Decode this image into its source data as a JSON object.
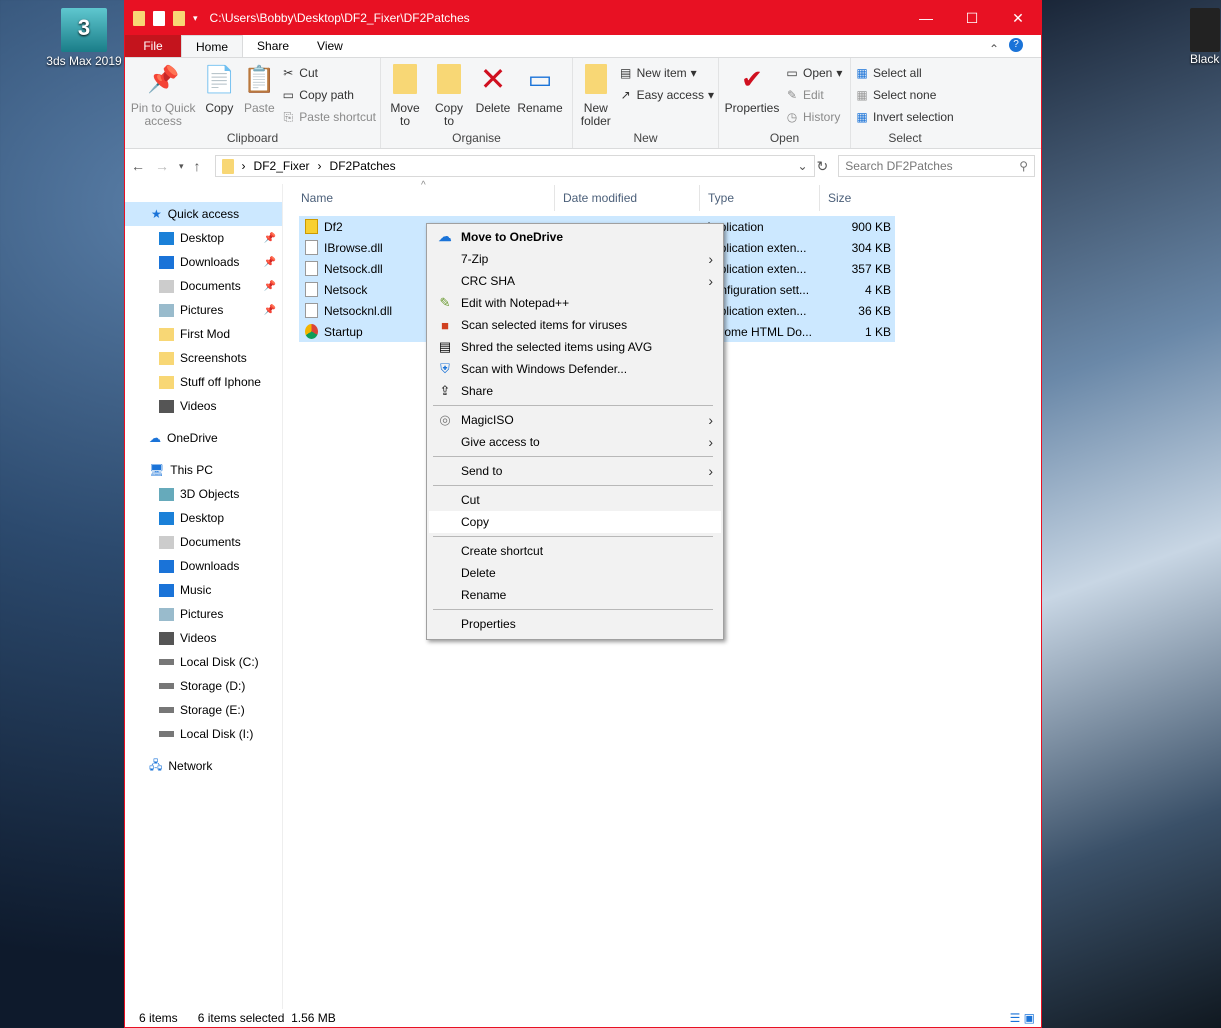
{
  "desktop": {
    "left_icon": "3ds Max 2019",
    "left_icon_badge": "3",
    "right_icon": "Black"
  },
  "window": {
    "title": "C:\\Users\\Bobby\\Desktop\\DF2_Fixer\\DF2Patches"
  },
  "tabs": [
    "File",
    "Home",
    "Share",
    "View"
  ],
  "ribbon": {
    "clipboard": {
      "label": "Clipboard",
      "pin": "Pin to Quick access",
      "copy": "Copy",
      "paste": "Paste",
      "cut": "Cut",
      "copy_path": "Copy path",
      "paste_shortcut": "Paste shortcut"
    },
    "organise": {
      "label": "Organise",
      "move_to": "Move to",
      "copy_to": "Copy to",
      "delete": "Delete",
      "rename": "Rename"
    },
    "new": {
      "label": "New",
      "new_folder": "New folder",
      "new_item": "New item",
      "easy_access": "Easy access"
    },
    "open": {
      "label": "Open",
      "properties": "Properties",
      "open": "Open",
      "edit": "Edit",
      "history": "History"
    },
    "select": {
      "label": "Select",
      "select_all": "Select all",
      "select_none": "Select none",
      "invert": "Invert selection"
    }
  },
  "address": {
    "crumbs": [
      "DF2_Fixer",
      "DF2Patches"
    ],
    "search_placeholder": "Search DF2Patches"
  },
  "nav": {
    "quick_access": "Quick access",
    "quick": [
      {
        "label": "Desktop",
        "pinned": true
      },
      {
        "label": "Downloads",
        "pinned": true
      },
      {
        "label": "Documents",
        "pinned": true
      },
      {
        "label": "Pictures",
        "pinned": true
      },
      {
        "label": "First Mod"
      },
      {
        "label": "Screenshots"
      },
      {
        "label": "Stuff off Iphone"
      },
      {
        "label": "Videos"
      }
    ],
    "onedrive": "OneDrive",
    "this_pc": "This PC",
    "pc": [
      "3D Objects",
      "Desktop",
      "Documents",
      "Downloads",
      "Music",
      "Pictures",
      "Videos",
      "Local Disk (C:)",
      "Storage (D:)",
      "Storage (E:)",
      "Local Disk (I:)"
    ],
    "network": "Network"
  },
  "columns": {
    "name": "Name",
    "date": "Date modified",
    "type": "Type",
    "size": "Size"
  },
  "files": [
    {
      "name": "Df2",
      "type": "Application",
      "size": "900 KB"
    },
    {
      "name": "IBrowse.dll",
      "type": "Application exten...",
      "size": "304 KB"
    },
    {
      "name": "Netsock.dll",
      "type": "Application exten...",
      "size": "357 KB"
    },
    {
      "name": "Netsock",
      "type": "Configuration sett...",
      "size": "4 KB"
    },
    {
      "name": "Netsocknl.dll",
      "type": "Application exten...",
      "size": "36 KB"
    },
    {
      "name": "Startup",
      "type": "Chrome HTML Do...",
      "size": "1 KB"
    }
  ],
  "context_menu": {
    "move_onedrive": "Move to OneDrive",
    "zip": "7-Zip",
    "crc": "CRC SHA",
    "notepad": "Edit with Notepad++",
    "scan_avg": "Scan selected items for viruses",
    "shred": "Shred the selected items using AVG",
    "defender": "Scan with Windows Defender...",
    "share": "Share",
    "magiciso": "MagicISO",
    "give_access": "Give access to",
    "send_to": "Send to",
    "cut": "Cut",
    "copy": "Copy",
    "create_shortcut": "Create shortcut",
    "delete": "Delete",
    "rename": "Rename",
    "properties": "Properties"
  },
  "status": {
    "items": "6 items",
    "selected": "6 items selected",
    "size": "1.56 MB"
  }
}
